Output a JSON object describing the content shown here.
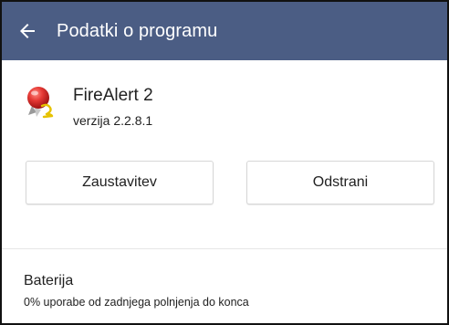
{
  "appbar": {
    "title": "Podatki o programu",
    "back_icon": "arrow-left-icon",
    "background_color": "#4b5d84"
  },
  "app": {
    "name": "FireAlert 2",
    "version": "verzija 2.2.8.1",
    "icon": "firealert-app-icon"
  },
  "actions": {
    "stop_label": "Zaustavitev",
    "remove_label": "Odstrani"
  },
  "battery": {
    "title": "Baterija",
    "subtitle": "0% uporabe od zadnjega polnjenja do konca"
  }
}
